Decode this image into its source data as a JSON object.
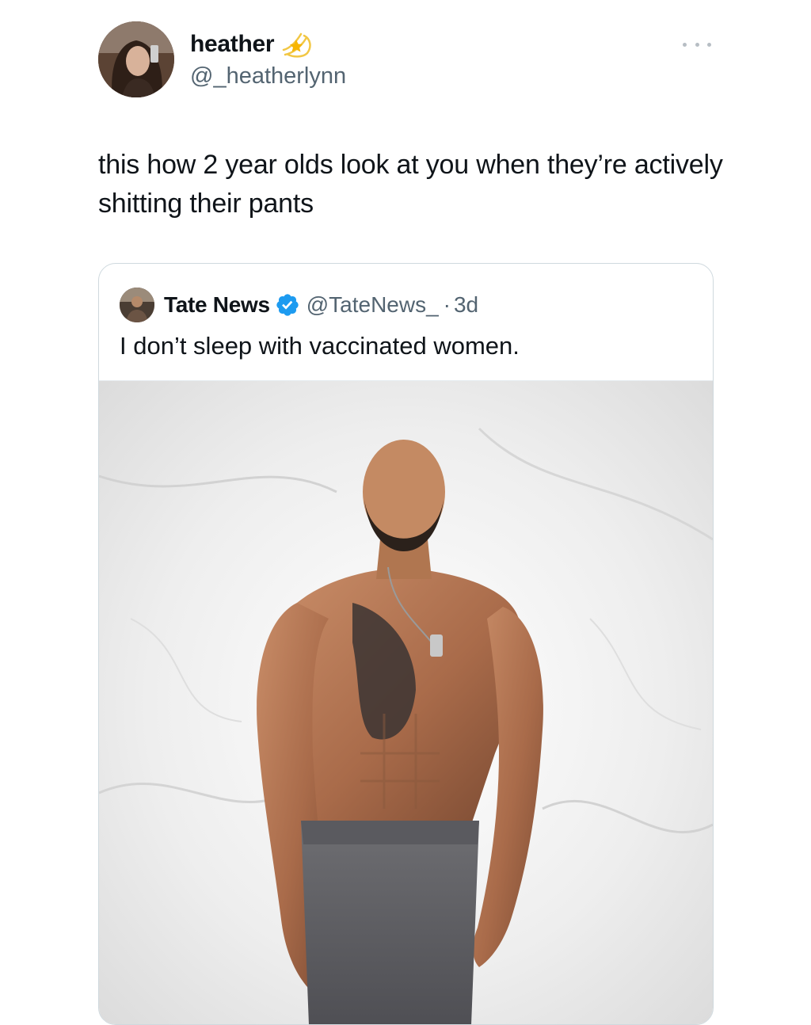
{
  "author": {
    "display_name": "heather",
    "handle": "@_heatherlynn",
    "badge_icon": "shooting-star-icon",
    "avatar": "user-avatar"
  },
  "tweet": {
    "text": "this how 2 year olds look at you when they’re actively shitting their pants",
    "more_icon": "more-options-icon"
  },
  "quote": {
    "display_name": "Tate News",
    "verified_icon": "verified-badge-icon",
    "handle": "@TateNews_",
    "separator": "·",
    "time": "3d",
    "text": "I don’t sleep with vaccinated women.",
    "media": "photo"
  },
  "colors": {
    "text_primary": "#0f1419",
    "text_secondary": "#536471",
    "verified_blue": "#1d9bf0",
    "border": "#cfd9de"
  }
}
